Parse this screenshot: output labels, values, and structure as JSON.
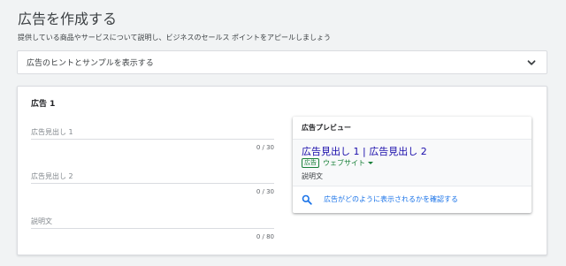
{
  "page": {
    "title": "広告を作成する",
    "subtitle": "提供している商品やサービスについて説明し、ビジネスのセールス ポイントをアピールしましょう"
  },
  "hint_panel": {
    "label": "広告のヒントとサンプルを表示する",
    "icon": "chevron-down-icon"
  },
  "ad": {
    "title": "広告 1",
    "fields": [
      {
        "placeholder": "広告見出し 1",
        "value": "",
        "counter": "0 / 30"
      },
      {
        "placeholder": "広告見出し 2",
        "value": "",
        "counter": "0 / 30"
      },
      {
        "placeholder": "説明文",
        "value": "",
        "counter": "0 / 80"
      }
    ]
  },
  "preview": {
    "title": "広告プレビュー",
    "headline": "広告見出し 1 | 広告見出し 2",
    "badge": "広告",
    "url": "ウェブサイト",
    "description": "説明文",
    "link_label": "広告がどのように表示されるかを確認する",
    "link_icon": "search-icon"
  },
  "colors": {
    "background": "#f1f3f4",
    "headline_link": "#1a0dab",
    "url_green": "#188038",
    "accent_blue": "#1a73e8"
  }
}
